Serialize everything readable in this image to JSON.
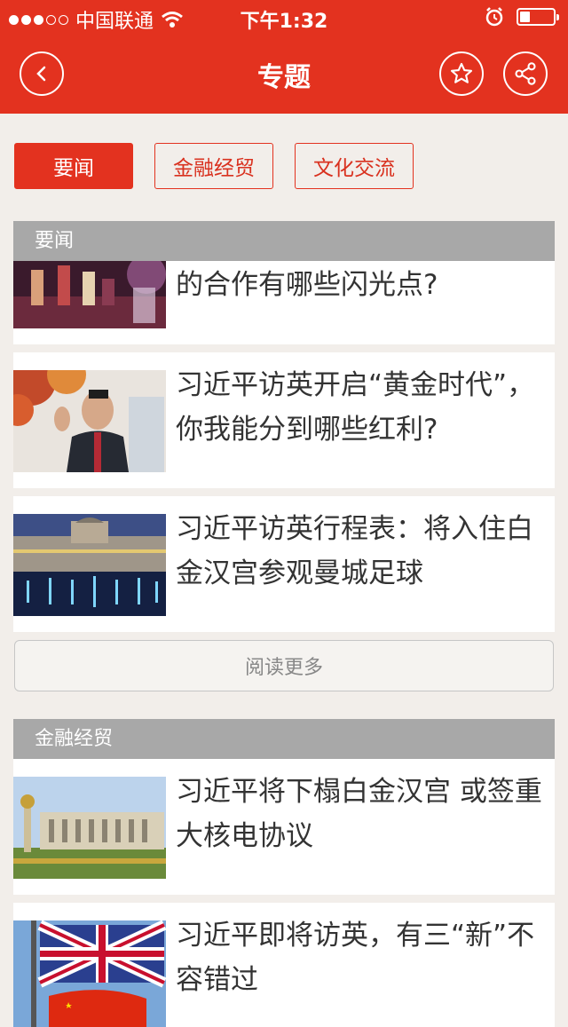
{
  "status_bar": {
    "carrier": "中国联通",
    "time": "下午1:32",
    "battery_level": 0.3
  },
  "nav": {
    "title": "专题"
  },
  "tabs": [
    {
      "label": "要闻",
      "active": true
    },
    {
      "label": "金融经贸",
      "active": false
    },
    {
      "label": "文化交流",
      "active": false
    }
  ],
  "sections": [
    {
      "title": "要闻",
      "articles": [
        {
          "title": "的合作有哪些闪光点?",
          "thumb": "concert-stage"
        },
        {
          "title": "习近平访英开启“黄金时代”，你我能分到哪些红利?",
          "thumb": "xi-waving-portrait"
        },
        {
          "title": "习近平访英行程表：将入住白金汉宫参观曼城足球",
          "thumb": "palace-fountains-night"
        }
      ],
      "more_label": "阅读更多"
    },
    {
      "title": "金融经贸",
      "articles": [
        {
          "title": "习近平将下榻白金汉宫 或签重大核电协议",
          "thumb": "buckingham-palace-day"
        },
        {
          "title": "习近平即将访英，有三“新”不容错过",
          "thumb": "uk-china-flags"
        }
      ]
    }
  ],
  "colors": {
    "brand_red": "#e3321f",
    "section_gray": "#a8a8a8",
    "background": "#f2eeea"
  },
  "icons": [
    "back-icon",
    "star-icon",
    "share-icon",
    "wifi-icon",
    "alarm-icon",
    "battery-icon"
  ]
}
